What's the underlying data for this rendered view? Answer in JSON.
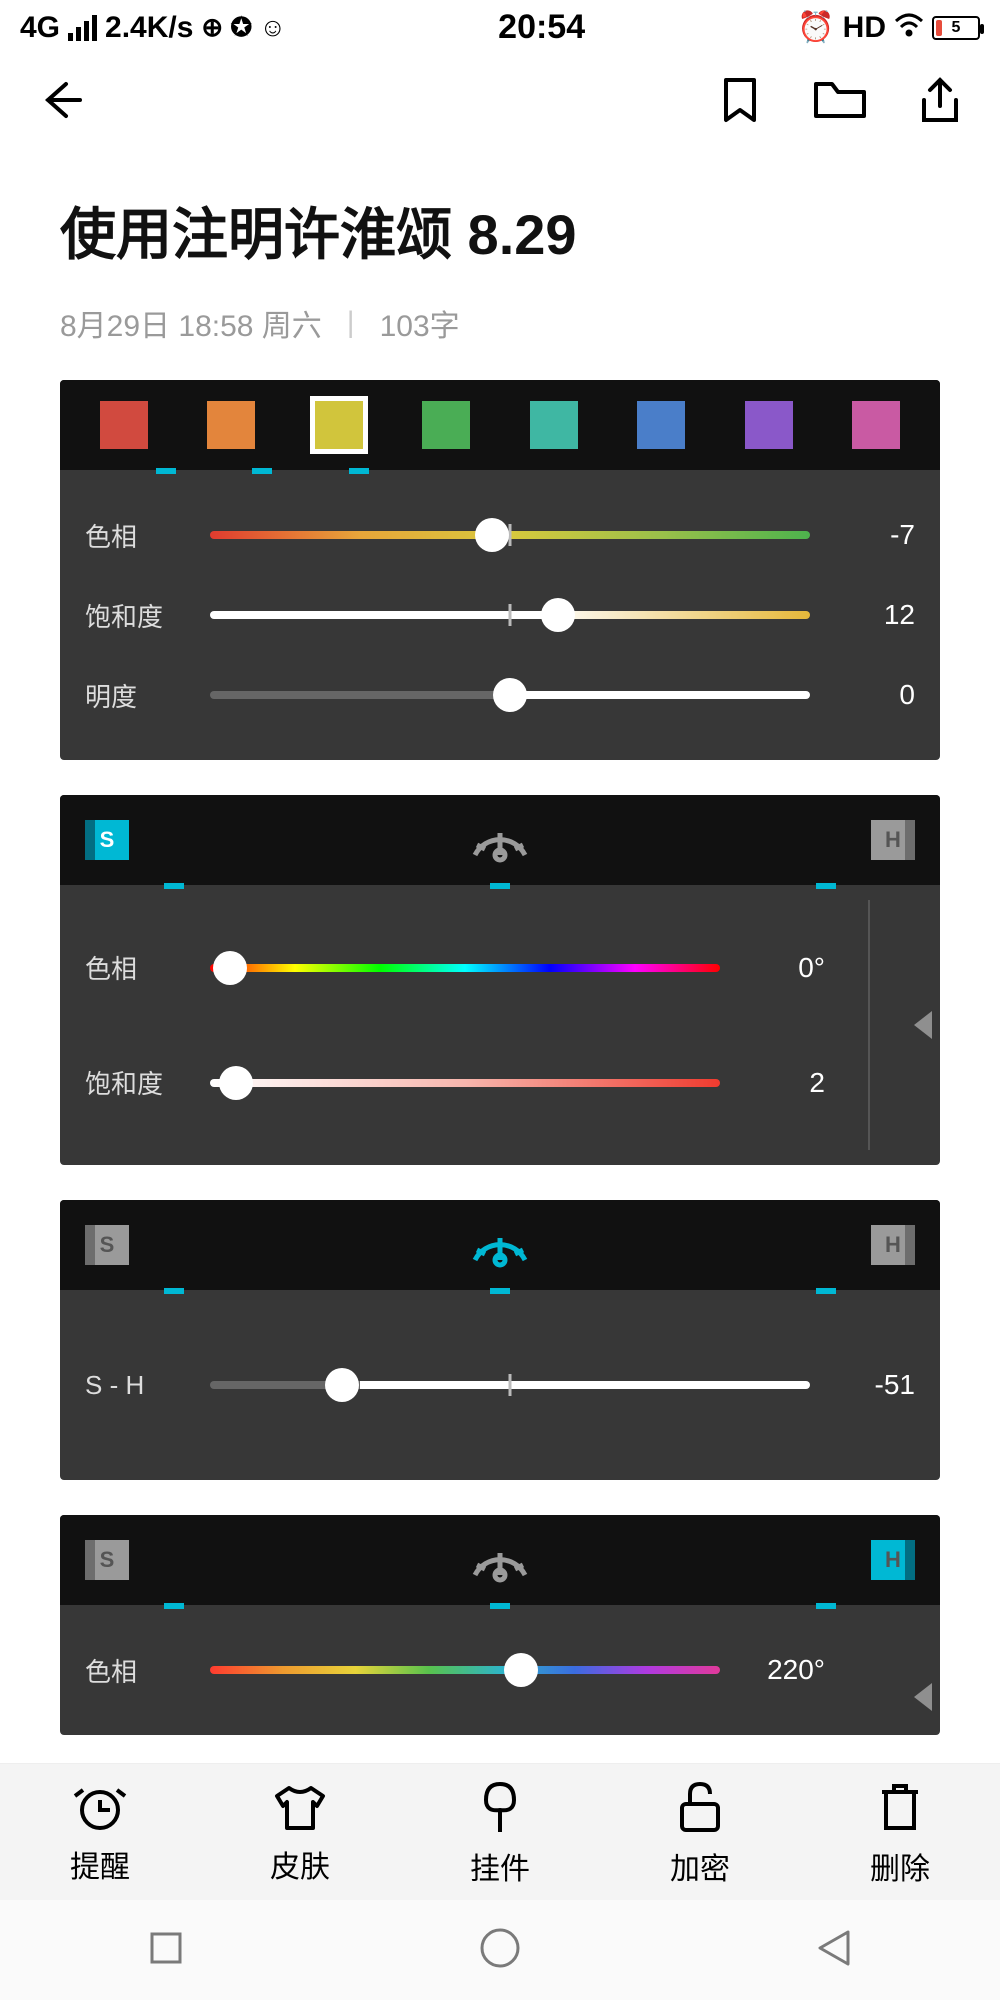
{
  "status": {
    "network": "4G",
    "speed": "2.4K/s",
    "time": "20:54",
    "hd": "HD",
    "battery": "5"
  },
  "note": {
    "title": "使用注明许淮颂 8.29",
    "date": "8月29日 18:58 周六",
    "word_count": "103字"
  },
  "panel1": {
    "swatches": [
      {
        "color": "#d14a3f",
        "selected": false
      },
      {
        "color": "#e3853c",
        "selected": false
      },
      {
        "color": "#d1c53c",
        "selected": true
      },
      {
        "color": "#4aad55",
        "selected": false
      },
      {
        "color": "#3fb7a3",
        "selected": false
      },
      {
        "color": "#4a7ec9",
        "selected": false
      },
      {
        "color": "#8a58c9",
        "selected": false
      },
      {
        "color": "#c95aa3",
        "selected": false
      }
    ],
    "ticks": [
      12,
      23,
      34
    ],
    "hue": {
      "label": "色相",
      "value": "-7",
      "pos": 47
    },
    "sat": {
      "label": "饱和度",
      "value": "12",
      "pos": 58
    },
    "light": {
      "label": "明度",
      "value": "0",
      "pos": 50
    }
  },
  "panel2": {
    "ticks": [
      13,
      50,
      87
    ],
    "hue": {
      "label": "色相",
      "value": "0°",
      "pos": 4
    },
    "sat": {
      "label": "饱和度",
      "value": "2",
      "pos": 5
    }
  },
  "panel3": {
    "ticks": [
      13,
      50,
      87
    ],
    "sh": {
      "label": "S  -  H",
      "value": "-51",
      "pos": 22
    }
  },
  "panel4": {
    "ticks": [
      13,
      50,
      87
    ],
    "hue": {
      "label": "色相",
      "value": "220°",
      "pos": 61
    }
  },
  "toolbar": {
    "remind": "提醒",
    "skin": "皮肤",
    "widget": "挂件",
    "lock": "加密",
    "delete": "删除"
  }
}
